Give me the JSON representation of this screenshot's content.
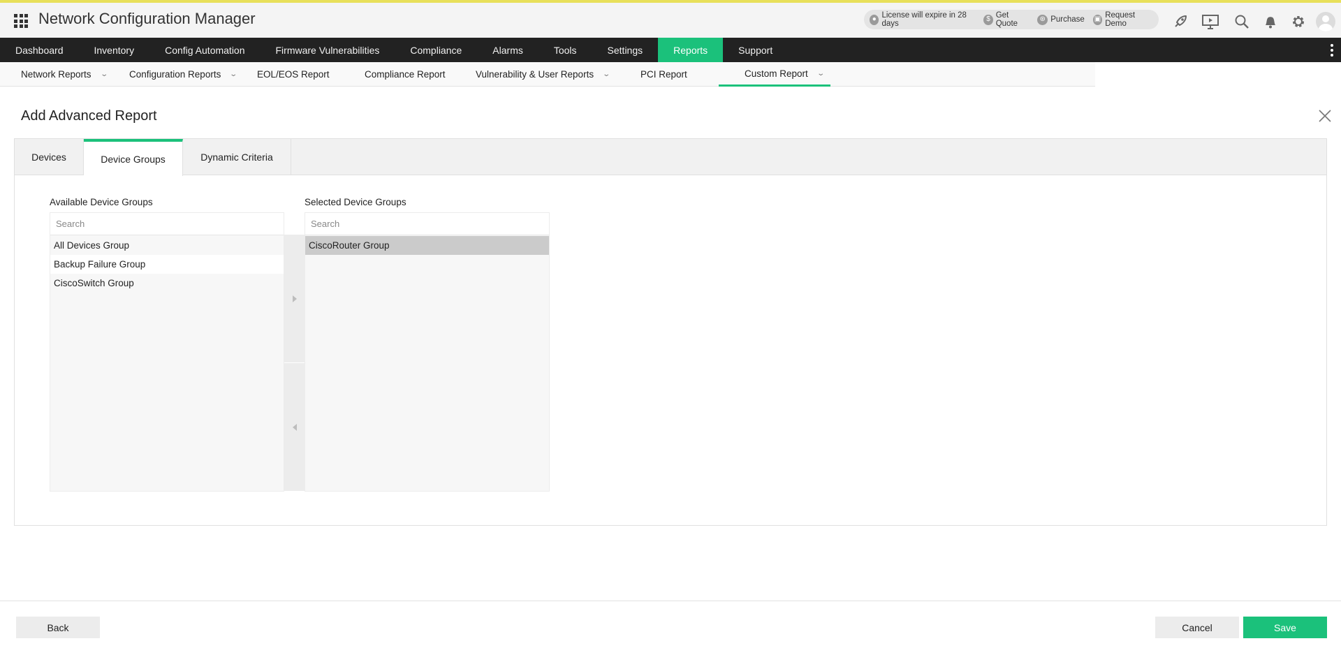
{
  "header": {
    "app_title": "Network Configuration Manager",
    "license": {
      "expiry_text": "License will expire in 28 days",
      "get_quote": "Get Quote",
      "purchase": "Purchase",
      "request_demo": "Request Demo"
    },
    "icons": [
      "rocket-icon",
      "presentation-icon",
      "search-icon",
      "bell-icon",
      "gear-icon",
      "user-avatar"
    ]
  },
  "main_nav": {
    "items": [
      "Dashboard",
      "Inventory",
      "Config Automation",
      "Firmware Vulnerabilities",
      "Compliance",
      "Alarms",
      "Tools",
      "Settings",
      "Reports",
      "Support"
    ],
    "active": "Reports",
    "accent_color": "#1bc17b"
  },
  "sub_nav": {
    "items": [
      "Network Reports",
      "Configuration Reports",
      "EOL/EOS Report",
      "Compliance Report",
      "Vulnerability & User Reports",
      "PCI Report",
      "Custom Report"
    ],
    "active": "Custom Report"
  },
  "page": {
    "title": "Add Advanced Report",
    "tabs": [
      "Devices",
      "Device Groups",
      "Dynamic Criteria"
    ],
    "active_tab": "Device Groups",
    "available": {
      "label": "Available Device Groups",
      "search_placeholder": "Search",
      "items": [
        "All Devices Group",
        "Backup Failure Group",
        "CiscoSwitch Group"
      ]
    },
    "selected": {
      "label": "Selected Device Groups",
      "search_placeholder": "Search",
      "items": [
        "CiscoRouter Group"
      ]
    }
  },
  "footer": {
    "back": "Back",
    "cancel": "Cancel",
    "save": "Save"
  }
}
